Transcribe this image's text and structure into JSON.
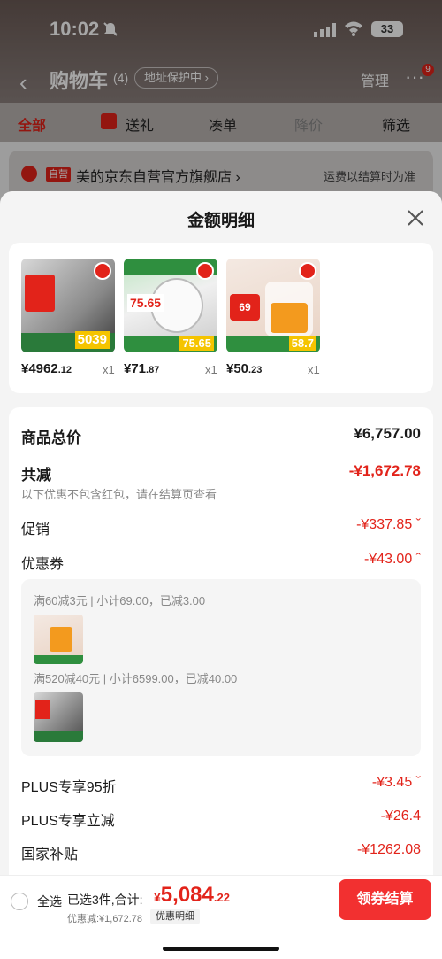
{
  "status": {
    "time": "10:02",
    "battery": "33"
  },
  "nav": {
    "title": "购物车",
    "count": "(4)",
    "address_pill": "地址保护中 ›",
    "manage": "管理",
    "more": "···",
    "badge": "9"
  },
  "tabs": [
    {
      "label": "全部"
    },
    {
      "label": "送礼"
    },
    {
      "label": "凑单"
    },
    {
      "label": "降价"
    },
    {
      "label": "筛选"
    }
  ],
  "shop": {
    "tag": "自营",
    "name": "美的京东自营官方旗舰店 ›",
    "shipping_note": "运费以结算时为准"
  },
  "sheet": {
    "title": "金额明细",
    "products": [
      {
        "price_int": "¥4962",
        "price_dec": ".12",
        "qty": "x1",
        "img_text": "5039"
      },
      {
        "price_int": "¥71",
        "price_dec": ".87",
        "qty": "x1",
        "img_text": "75.65"
      },
      {
        "price_int": "¥50",
        "price_dec": ".23",
        "qty": "x1",
        "img_text": "58.7"
      }
    ],
    "rows": {
      "total_label": "商品总价",
      "total_value": "¥6,757.00",
      "reduce_label": "共减",
      "reduce_value": "-¥1,672.78",
      "reduce_note": "以下优惠不包含红包，请在结算页查看",
      "promo_label": "促销",
      "promo_value": "-¥337.85 ˇ",
      "coupon_label": "优惠券",
      "coupon_value": "-¥43.00 ˆ",
      "plus95_label": "PLUS专享95折",
      "plus95_value": "-¥3.45 ˇ",
      "plus_instant_label": "PLUS专享立减",
      "plus_instant_value": "-¥26.4",
      "subsidy_label": "国家补贴",
      "subsidy_value": "-¥1262.08"
    },
    "coupons": [
      {
        "line": "满60减3元 | 小计69.00，已减3.00"
      },
      {
        "line": "满520减40元 | 小计6599.00，已减40.00"
      }
    ]
  },
  "bottom": {
    "select_all": "全选",
    "selected_text": "已选3件,合计:",
    "yen": "¥",
    "total_int": "5,084",
    "total_dec": ".22",
    "discount": "优惠减:¥1,672.78",
    "detail_pill": "优惠明细",
    "checkout": "领券结算"
  }
}
